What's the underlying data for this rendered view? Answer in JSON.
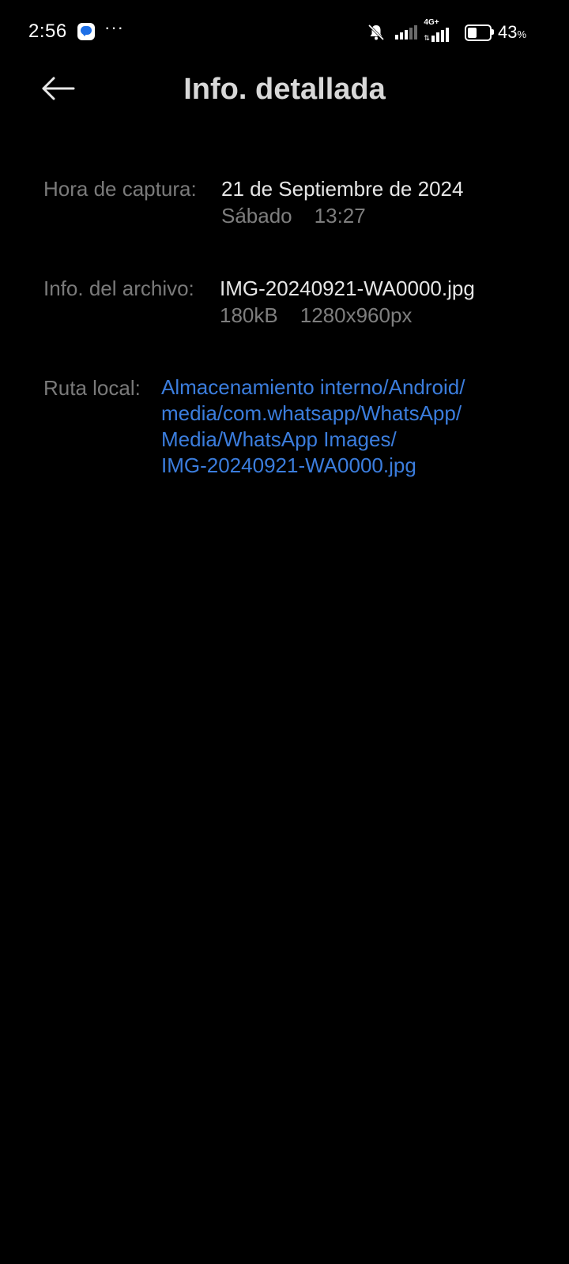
{
  "status_bar": {
    "time": "2:56",
    "more": "···",
    "network": "4G+",
    "battery_level": 43,
    "battery_value": "43",
    "battery_unit": "%",
    "icons": [
      "messaging-app-icon",
      "bell-off-icon",
      "signal-icon",
      "4g-plus-signal-icon",
      "battery-icon"
    ]
  },
  "header": {
    "back_icon": "arrow-left-icon",
    "title": "Info. detallada"
  },
  "details": {
    "capture": {
      "label": "Hora de captura:",
      "date": "21 de Septiembre de 2024",
      "weekday": "Sábado",
      "time": "13:27"
    },
    "file": {
      "label": "Info. del archivo:",
      "name": "IMG-20240921-WA0000.jpg",
      "size": "180kB",
      "resolution": "1280x960px"
    },
    "path": {
      "label": "Ruta local:",
      "lines": [
        "Almacenamiento interno/Android/",
        "media/com.whatsapp/WhatsApp/",
        "Media/WhatsApp Images/",
        "IMG-20240921-WA0000.jpg"
      ]
    }
  },
  "colors": {
    "background": "#000000",
    "title": "#d8d8d8",
    "label": "#7a7a7a",
    "value": "#e6e6e6",
    "link": "#3b7ddd"
  }
}
